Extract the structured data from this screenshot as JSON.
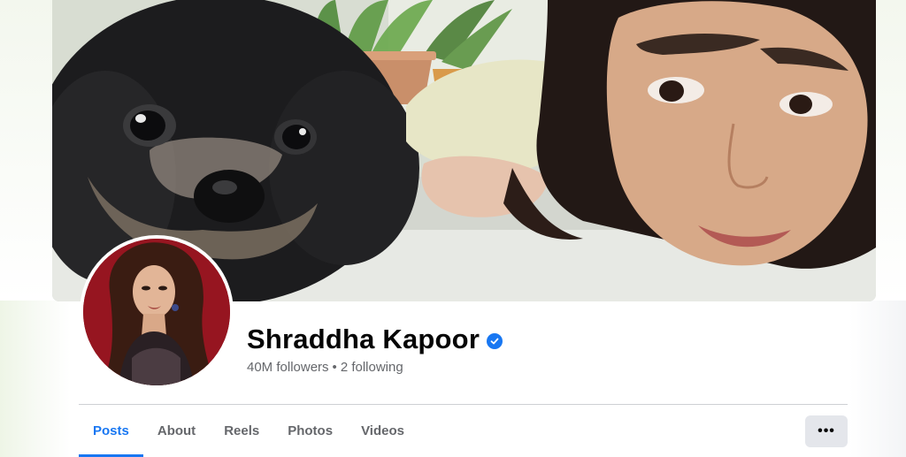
{
  "profile": {
    "name": "Shraddha Kapoor",
    "verified": true,
    "followers": "40M followers",
    "separator": "•",
    "following": "2 following"
  },
  "tabs": [
    {
      "label": "Posts",
      "active": true
    },
    {
      "label": "About",
      "active": false
    },
    {
      "label": "Reels",
      "active": false
    },
    {
      "label": "Photos",
      "active": false
    },
    {
      "label": "Videos",
      "active": false
    }
  ],
  "more_button": {
    "icon": "more-dots-icon",
    "label": "•••"
  },
  "colors": {
    "accent": "#1877f2",
    "text_primary": "#050505",
    "text_secondary": "#65676b",
    "button_bg": "#e4e6eb"
  }
}
